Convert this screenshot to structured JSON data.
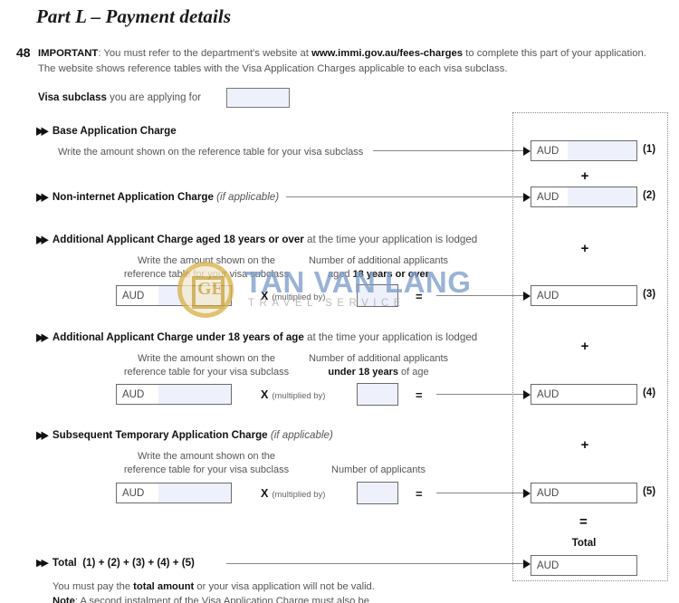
{
  "document": {
    "part_title": "Part L – Payment details",
    "question_number": "48"
  },
  "important": {
    "label": "IMPORTANT",
    "line1_a": ": You must refer to the department's website at ",
    "url": "www.immi.gov.au/fees-charges",
    "line1_b": " to complete this part of your application.",
    "line2": "The website shows reference tables with the Visa Application Charges applicable to each visa subclass."
  },
  "visa_subclass": {
    "label_bold": "Visa subclass",
    "label_rest": " you are applying for",
    "value": ""
  },
  "sections": {
    "base": {
      "title": "Base Application Charge",
      "note": "Write the amount shown on the reference table for your visa subclass"
    },
    "non_internet": {
      "title": "Non-internet Application Charge",
      "qualifier": "(if applicable)"
    },
    "adult": {
      "title_bold": "Additional Applicant Charge aged 18 years or over",
      "title_rest": " at the time your application is lodged",
      "amount_note_l1": "Write the amount shown on the",
      "amount_note_l2": "reference table for your visa subclass",
      "count_note_l1": "Number of additional applicants",
      "count_note_l2_a": "aged ",
      "count_note_l2_b": "18 years or over",
      "amount_value": "",
      "count_value": ""
    },
    "child": {
      "title_bold": "Additional Applicant Charge under 18 years of age",
      "title_rest": " at the time your application is lodged",
      "amount_note_l1": "Write the amount shown on the",
      "amount_note_l2": "reference table for your visa subclass",
      "count_note_l1": "Number of additional applicants",
      "count_note_l2_a": "under 18 years",
      "count_note_l2_b": " of age",
      "amount_value": "",
      "count_value": ""
    },
    "subsequent": {
      "title": "Subsequent Temporary Application Charge",
      "qualifier": "(if applicable)",
      "amount_note_l1": "Write the amount shown on the",
      "amount_note_l2": "reference table for your visa subclass",
      "count_note": "Number of applicants",
      "amount_value": "",
      "count_value": ""
    }
  },
  "operators": {
    "multiply_symbol": "X",
    "multiply_word": "(multiplied by)",
    "equals": "=",
    "plus": "+"
  },
  "currency": {
    "code": "AUD"
  },
  "summary": {
    "ref_1": "(1)",
    "ref_2": "(2)",
    "ref_3": "(3)",
    "ref_4": "(4)",
    "ref_5": "(5)",
    "total_word": "Total",
    "value_1": "",
    "value_2": "",
    "value_3": "",
    "value_4": "",
    "value_5": "",
    "value_total": ""
  },
  "total_row": {
    "label": "Total",
    "formula": "(1) + (2) + (3) + (4) + (5)",
    "note_a": "You must pay the ",
    "note_b": "total amount",
    "note_c": " or your visa application will not be valid.",
    "note2_bold": "Note",
    "note2_rest": ": A second instalment of the Visa Application Charge must also be"
  },
  "watermark": {
    "brand": "TAN VAN LANG",
    "tagline": "TRAVEL SERVICE",
    "logo_text": "GE",
    "brand_color": "#7e9ec9",
    "logo_color": "#c8a23c"
  }
}
